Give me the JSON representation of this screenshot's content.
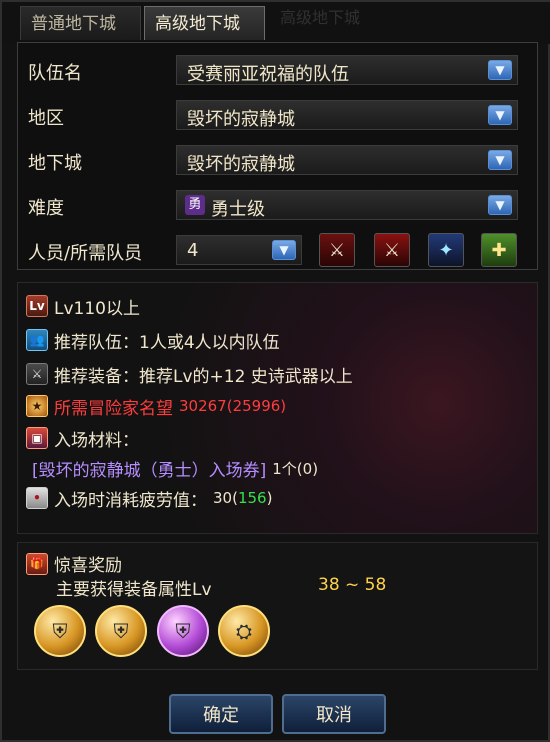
{
  "tabs": [
    {
      "label": "普通地下城"
    },
    {
      "label": "高级地下城"
    }
  ],
  "ghost_title": "高级地下城",
  "form": {
    "team_name_label": "队伍名",
    "team_name_value": "受赛丽亚祝福的队伍",
    "region_label": "地区",
    "region_value": "毁坏的寂静城",
    "dungeon_label": "地下城",
    "dungeon_value": "毁坏的寂静城",
    "difficulty_label": "难度",
    "difficulty_badge": "勇",
    "difficulty_value": "勇士级",
    "members_label": "人员/所需队员",
    "members_value": "4"
  },
  "info": {
    "level_text": "Lv110以上",
    "recommended_team": "推荐队伍：1人或4人以内队伍",
    "recommended_gear": "推荐装备：推荐Lv的+12 史诗武器以上",
    "fame_label": "所需冒险家名望",
    "fame_value": "30267(25996)",
    "materials_label": "入场材料：",
    "ticket_text": "[毁坏的寂静城（勇士）入场券]",
    "ticket_count": "1个(0)",
    "fatigue_label": "入场时消耗疲劳值：",
    "fatigue_value": "30(",
    "fatigue_value_green": "156",
    "fatigue_value_end": ")"
  },
  "reward": {
    "title": "惊喜奖励",
    "subtitle": "主要获得装备属性Lv",
    "range": "38 ~ 58"
  },
  "buttons": {
    "ok": "确定",
    "cancel": "取消"
  },
  "colors": {
    "accent_blue": "#2f66b5",
    "fame_red": "#ff3d3d",
    "gold": "#ffd24a",
    "fatigue_green": "#35e14a",
    "ticket_purple": "#b68dff"
  }
}
